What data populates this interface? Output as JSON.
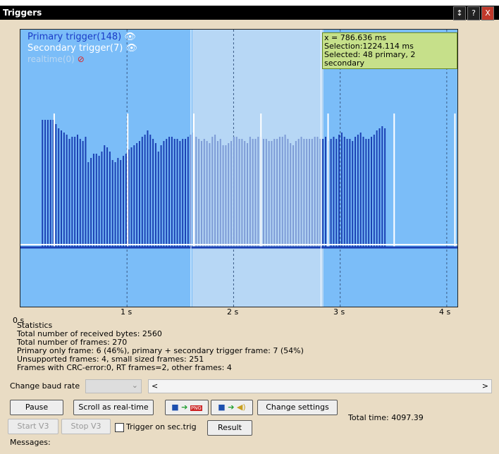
{
  "window": {
    "title": "Triggers",
    "btn_resize": "↕",
    "btn_help": "?",
    "btn_close": "X"
  },
  "chart_data": {
    "type": "bar",
    "legend": {
      "primary": "Primary trigger(148)",
      "secondary": "Secondary trigger(7)",
      "realtime": "realtime(0)"
    },
    "tooltip": {
      "line1": "x = 786.636 ms",
      "line2": "Selection:1224.114 ms",
      "line3": "Selected: 48 primary, 2 secondary"
    },
    "xticks": [
      "0 s",
      "1 s",
      "2 s",
      "3 s",
      "4 s"
    ],
    "xlim": [
      0,
      4.1
    ],
    "selection": [
      1.6,
      2.82
    ],
    "bar_start": 0.2,
    "bar_step": 0.0253,
    "primary_values": [
      60,
      60,
      60,
      60,
      60,
      58,
      56,
      55,
      54,
      53,
      51,
      52,
      52,
      53,
      51,
      50,
      52,
      40,
      42,
      44,
      44,
      43,
      45,
      48,
      47,
      45,
      41,
      40,
      42,
      41,
      43,
      44,
      46,
      47,
      48,
      49,
      50,
      52,
      53,
      55,
      53,
      51,
      49,
      45,
      48,
      50,
      51,
      52,
      52,
      51,
      51,
      50,
      51,
      51,
      52,
      53,
      54,
      52,
      51,
      50,
      51,
      50,
      49,
      52,
      53,
      50,
      51,
      48,
      48,
      49,
      50,
      52,
      52,
      51,
      51,
      50,
      49,
      52,
      51,
      51,
      52,
      52,
      51,
      51,
      50,
      50,
      51,
      51,
      52,
      52,
      53,
      51,
      49,
      48,
      50,
      51,
      52,
      51,
      51,
      51,
      51,
      52,
      52,
      51,
      51,
      52,
      50,
      51,
      52,
      51,
      53,
      54,
      52,
      51,
      51,
      50,
      52,
      53,
      54,
      52,
      51,
      51,
      52,
      53,
      55,
      56,
      57,
      56
    ],
    "secondary_x": [
      0.31,
      1.0,
      1.62,
      2.25,
      2.88,
      3.5,
      4.07
    ],
    "secondary_value": 63,
    "ylim": [
      0,
      100
    ]
  },
  "stats": {
    "title": "Statistics",
    "line1": "Total number of received bytes: 2560",
    "line2": "Total number of frames: 270",
    "line3": "Primary only frame: 6 (46%), primary + secondary trigger frame: 7 (54%)",
    "line4": "Unsupported frames: 4, small sized frames: 251",
    "line5": "Frames with CRC-error:0, RT frames=2, other frames: 4"
  },
  "controls": {
    "baud_label": "Change baud rate",
    "pause": "Pause",
    "scroll": "Scroll as real-time",
    "png_badge": "PNG",
    "change_settings": "Change settings",
    "total_time": "Total time: 4097.39",
    "start_v3": "Start V3",
    "stop_v3": "Stop V3",
    "trigger_sec": "Trigger on sec.trig",
    "result": "Result",
    "messages": "Messages:",
    "scroll_left": "<",
    "scroll_right": ">"
  }
}
